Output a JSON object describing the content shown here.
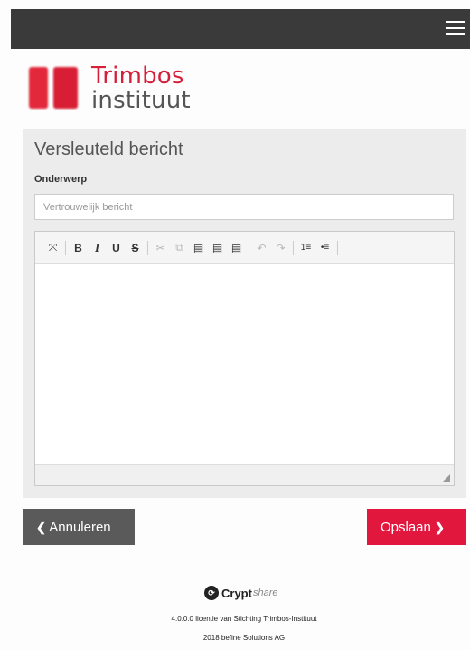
{
  "header": {
    "menu_icon": "hamburger-icon"
  },
  "logo": {
    "line1": "Trimbos",
    "line2": "instituut",
    "brand_color": "#d6203a"
  },
  "form": {
    "title": "Versleuteld bericht",
    "subject_label": "Onderwerp",
    "subject_value": "",
    "subject_placeholder": "Vertrouwelijk bericht",
    "message_value": ""
  },
  "toolbar": {
    "items": [
      {
        "name": "maximize-icon",
        "glyph": "⤧",
        "enabled": true
      },
      {
        "name": "bold-icon",
        "glyph": "B",
        "enabled": true
      },
      {
        "name": "italic-icon",
        "glyph": "I",
        "enabled": true
      },
      {
        "name": "underline-icon",
        "glyph": "U",
        "enabled": true
      },
      {
        "name": "strikethrough-icon",
        "glyph": "S",
        "enabled": true
      },
      {
        "name": "cut-icon",
        "glyph": "✂",
        "enabled": false
      },
      {
        "name": "copy-icon",
        "glyph": "⧉",
        "enabled": false
      },
      {
        "name": "paste-icon",
        "glyph": "▤",
        "enabled": true
      },
      {
        "name": "paste-text-icon",
        "glyph": "▤",
        "enabled": true
      },
      {
        "name": "paste-word-icon",
        "glyph": "▤",
        "enabled": true
      },
      {
        "name": "undo-icon",
        "glyph": "↶",
        "enabled": false
      },
      {
        "name": "redo-icon",
        "glyph": "↷",
        "enabled": false
      },
      {
        "name": "numbered-list-icon",
        "glyph": "≡",
        "enabled": true
      },
      {
        "name": "bulleted-list-icon",
        "glyph": "≡",
        "enabled": true
      }
    ]
  },
  "buttons": {
    "cancel_label": "Annuleren",
    "cancel_icon": "chevron-left-icon",
    "save_label": "Opslaan",
    "save_icon": "chevron-right-icon",
    "cancel_color": "#5a5a5a",
    "save_color": "#e2173d"
  },
  "footer": {
    "brand_bold": "Crypt",
    "brand_light": "share",
    "license": "4.0.0.0 licentie van Stichting Trimbos-Instituut",
    "copyright": "2018 befine Solutions AG"
  }
}
